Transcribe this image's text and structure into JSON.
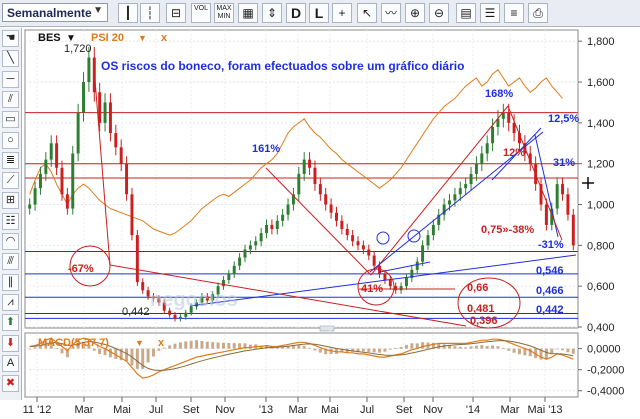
{
  "toolbar": {
    "period": "Semanalmente",
    "buttons": [
      {
        "name": "candles-icon",
        "glyph": "┃"
      },
      {
        "name": "bars-icon",
        "glyph": "┆"
      },
      {
        "name": "compare-button",
        "glyph": "⊟"
      },
      {
        "name": "vol-button",
        "glyph": "VOL"
      },
      {
        "name": "maxmin-button",
        "glyph": "MAX MIN"
      },
      {
        "name": "grid-icon",
        "glyph": "▦"
      },
      {
        "name": "scale-icon",
        "glyph": "⇕"
      },
      {
        "name": "D-button",
        "glyph": "D"
      },
      {
        "name": "L-button",
        "glyph": "L"
      },
      {
        "name": "crosshair-icon",
        "glyph": "+"
      },
      {
        "name": "pointer-icon",
        "glyph": "↖"
      },
      {
        "name": "trend-icon",
        "glyph": "〰"
      },
      {
        "name": "zoom-in-icon",
        "glyph": "⊕"
      },
      {
        "name": "zoom-out-icon",
        "glyph": "⊖"
      },
      {
        "name": "calendar-icon",
        "glyph": "▤"
      },
      {
        "name": "settings-icon",
        "glyph": "☰"
      },
      {
        "name": "layers-icon",
        "glyph": "≡"
      },
      {
        "name": "print-icon",
        "glyph": "⎙"
      }
    ]
  },
  "left_tools": [
    {
      "name": "hand-tool-icon",
      "glyph": "☚"
    },
    {
      "name": "line-tool-icon",
      "glyph": "╲"
    },
    {
      "name": "hline-tool-icon",
      "glyph": "─"
    },
    {
      "name": "channel-tool-icon",
      "glyph": "⫽"
    },
    {
      "name": "rectangle-tool-icon",
      "glyph": "▭"
    },
    {
      "name": "circle-tool-icon",
      "glyph": "○"
    },
    {
      "name": "fib-tool-icon",
      "glyph": "≣"
    },
    {
      "name": "fan-tool-icon",
      "glyph": "⟋"
    },
    {
      "name": "gann-tool-icon",
      "glyph": "⊞"
    },
    {
      "name": "levels-tool-icon",
      "glyph": "☷"
    },
    {
      "name": "arc-tool-icon",
      "glyph": "◠"
    },
    {
      "name": "speed-tool-icon",
      "glyph": "⫻"
    },
    {
      "name": "cycle-tool-icon",
      "glyph": "∥"
    },
    {
      "name": "pitchfork-tool-icon",
      "glyph": "⩘"
    },
    {
      "name": "buy-arrow-icon",
      "glyph": "⬆"
    },
    {
      "name": "sell-arrow-icon",
      "glyph": "⬇"
    },
    {
      "name": "text-tool-icon",
      "glyph": "A"
    },
    {
      "name": "delete-tool-icon",
      "glyph": "✖"
    }
  ],
  "colors": {
    "bull": "#2e7d32",
    "bear": "#cc1f1f",
    "index_line": "#e07b1a",
    "blue": "#1f2ee0",
    "red": "#cc1f1f",
    "macd_line": "#e07b1a",
    "macd_signal": "#8a6a3a",
    "hist": "#c9a98a"
  },
  "legend": {
    "symbol": "BES",
    "compare": "PSI 20",
    "close": "x"
  },
  "macd_legend": "MACD(5,37,7)",
  "macd_close": "x",
  "annotations": {
    "headline": "OS riscos do boneco, foram efectuados sobre um gráfico diário",
    "pct_161": "161%",
    "pct_168": "168%",
    "pct_125": "12,5%",
    "pct_12": "12%",
    "pct_31": "31%",
    "pct_075_38": "0,75»-38%",
    "pct_m31": "-31%",
    "pct_m67": "-67%",
    "pct_41": "41%",
    "val_066": "0,66",
    "val_0481": "0,481",
    "val_0396": "0,396",
    "val_0546": "0,546",
    "val_0466": "0,466",
    "val_0442r": "0,442",
    "max_1720": "1,720",
    "min_0442": "0,442"
  },
  "chart_data": {
    "type": "candlestick",
    "symbol": "BES",
    "compare_series": "PSI 20",
    "x_ticks": [
      "11 '12",
      "Mar",
      "Mai",
      "Jul",
      "Set",
      "Nov",
      "'13",
      "Mar",
      "Mai",
      "Jul",
      "Set",
      "Nov",
      "'14",
      "Mar",
      "Mai '13"
    ],
    "y_ticks": [
      "1,800",
      "1,600",
      "1,400",
      "1,200",
      "1,000",
      "0,800",
      "0,600",
      "0,400"
    ],
    "ylim": [
      0.4,
      1.85
    ],
    "macd_ticks": [
      "0,0000",
      "-0,2000",
      "-0,4000"
    ],
    "macd_ylim": [
      -0.45,
      0.12
    ],
    "levels": [
      1.45,
      1.2,
      1.13,
      0.77,
      0.66,
      0.546,
      0.466,
      0.442
    ],
    "price": [
      1.0,
      1.08,
      1.15,
      1.22,
      1.3,
      1.18,
      1.05,
      0.98,
      1.25,
      1.45,
      1.6,
      1.72,
      1.55,
      1.4,
      1.5,
      1.35,
      1.28,
      1.2,
      1.05,
      0.85,
      0.62,
      0.58,
      0.55,
      0.54,
      0.52,
      0.48,
      0.46,
      0.44,
      0.45,
      0.47,
      0.5,
      0.52,
      0.55,
      0.53,
      0.56,
      0.6,
      0.63,
      0.66,
      0.7,
      0.74,
      0.78,
      0.8,
      0.82,
      0.86,
      0.9,
      0.88,
      0.92,
      0.95,
      1.0,
      1.05,
      1.15,
      1.22,
      1.18,
      1.1,
      1.05,
      1.0,
      0.96,
      0.92,
      0.88,
      0.85,
      0.82,
      0.8,
      0.78,
      0.75,
      0.7,
      0.66,
      0.63,
      0.6,
      0.58,
      0.6,
      0.64,
      0.68,
      0.72,
      0.8,
      0.85,
      0.9,
      0.95,
      1.0,
      1.02,
      1.05,
      1.08,
      1.1,
      1.15,
      1.2,
      1.25,
      1.3,
      1.38,
      1.42,
      1.45,
      1.4,
      1.35,
      1.3,
      1.25,
      1.2,
      1.1,
      1.0,
      0.9,
      0.98,
      1.1,
      1.05,
      0.95,
      0.8
    ],
    "psi20": [
      1.05,
      1.12,
      1.18,
      1.2,
      1.16,
      1.1,
      1.05,
      1.0,
      1.05,
      1.08,
      1.1,
      1.08,
      1.05,
      1.02,
      1.0,
      0.98,
      0.97,
      0.96,
      0.95,
      0.94,
      0.93,
      0.92,
      0.9,
      0.88,
      0.87,
      0.86,
      0.85,
      0.86,
      0.88,
      0.9,
      0.92,
      0.95,
      0.98,
      1.0,
      1.02,
      1.04,
      1.05,
      1.04,
      1.06,
      1.08,
      1.1,
      1.12,
      1.15,
      1.18,
      1.2,
      1.22,
      1.25,
      1.3,
      1.35,
      1.38,
      1.4,
      1.42,
      1.38,
      1.35,
      1.33,
      1.3,
      1.27,
      1.25,
      1.22,
      1.2,
      1.18,
      1.16,
      1.14,
      1.12,
      1.1,
      1.08,
      1.1,
      1.12,
      1.15,
      1.18,
      1.22,
      1.26,
      1.3,
      1.34,
      1.38,
      1.42,
      1.45,
      1.48,
      1.5,
      1.52,
      1.55,
      1.58,
      1.6,
      1.62,
      1.58,
      1.6,
      1.64,
      1.66,
      1.62,
      1.58,
      1.6,
      1.62,
      1.58,
      1.55,
      1.57,
      1.6,
      1.62,
      1.58,
      1.55,
      1.52
    ],
    "macd": [
      0.02,
      0.03,
      0.05,
      0.08,
      0.1,
      0.06,
      0.02,
      -0.02,
      0.04,
      0.08,
      0.1,
      0.09,
      0.05,
      0.02,
      0.0,
      -0.03,
      -0.06,
      -0.09,
      -0.12,
      -0.18,
      -0.24,
      -0.28,
      -0.27,
      -0.25,
      -0.22,
      -0.2,
      -0.18,
      -0.16,
      -0.14,
      -0.12,
      -0.1,
      -0.08,
      -0.07,
      -0.06,
      -0.05,
      -0.04,
      -0.03,
      -0.02,
      -0.01,
      0.0,
      0.01,
      0.01,
      0.02,
      0.02,
      0.03,
      0.02,
      0.02,
      0.03,
      0.04,
      0.05,
      0.06,
      0.06,
      0.05,
      0.03,
      0.01,
      -0.01,
      -0.02,
      -0.03,
      -0.03,
      -0.04,
      -0.04,
      -0.05,
      -0.05,
      -0.06,
      -0.07,
      -0.08,
      -0.08,
      -0.07,
      -0.06,
      -0.05,
      -0.03,
      -0.01,
      0.0,
      0.02,
      0.03,
      0.04,
      0.05,
      0.05,
      0.05,
      0.05,
      0.05,
      0.05,
      0.06,
      0.07,
      0.08,
      0.08,
      0.09,
      0.09,
      0.08,
      0.06,
      0.04,
      0.02,
      0.0,
      -0.02,
      -0.05,
      -0.08,
      -0.1,
      -0.08,
      -0.05,
      -0.06,
      -0.08,
      -0.1
    ]
  }
}
